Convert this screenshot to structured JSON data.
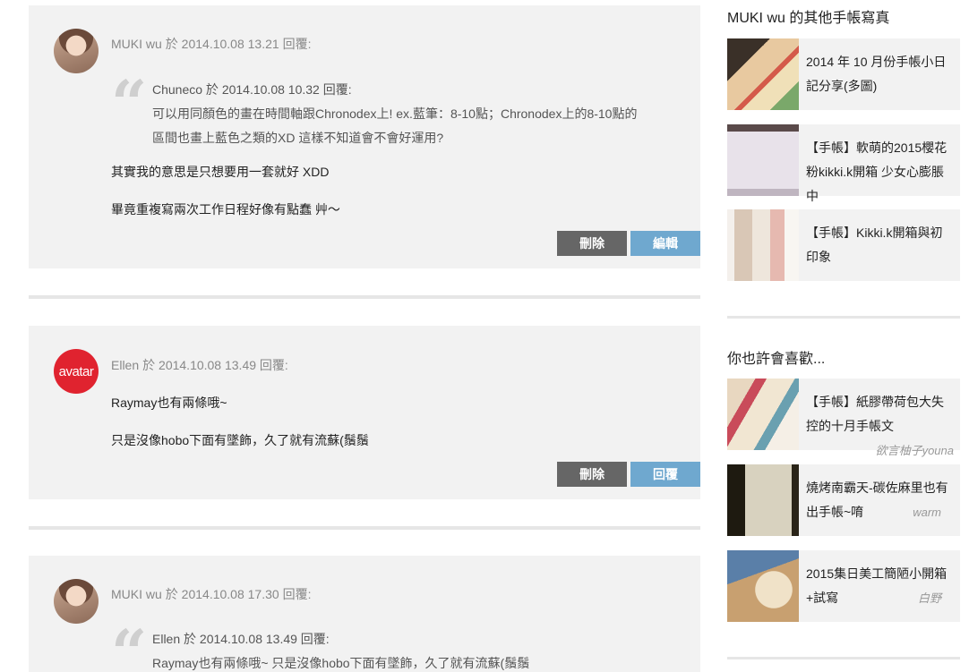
{
  "comments": [
    {
      "author": "MUKI wu",
      "date_text": "於 2014.10.08 13.21 回覆:",
      "quote_meta": "Chuneco 於 2014.10.08 10.32 回覆:",
      "quote_line1": "可以用同顏色的畫在時間軸跟Chronodex上! ex.藍筆：8-10點；Chronodex上的8-10點的",
      "quote_line2": "區間也畫上藍色之類的XD 這樣不知道會不會好運用?",
      "line1": "其實我的意思是只想要用一套就好 XDD",
      "line2": "畢竟重複寫兩次工作日程好像有點蠢 艸〜",
      "btn_left": "刪除",
      "btn_right": "編輯"
    },
    {
      "author": "Ellen",
      "avatar_text": "avatar",
      "date_text": "於 2014.10.08 13.49 回覆:",
      "line1": "Raymay也有兩條哦~",
      "line2": "只是沒像hobo下面有墜飾，久了就有流蘇(鬚鬚",
      "btn_left": "刪除",
      "btn_right": "回覆"
    },
    {
      "author": "MUKI wu",
      "date_text": "於 2014.10.08 17.30 回覆:",
      "quote_meta": "Ellen 於 2014.10.08 13.49 回覆:",
      "quote_line1": "Raymay也有兩條哦~ 只是沒像hobo下面有墜飾，久了就有流蘇(鬚鬚"
    }
  ],
  "sidebar": {
    "section1_title": "MUKI wu 的其他手帳寫真",
    "section1_items": [
      {
        "title": "2014 年 10 月份手帳小日記分享(多圖)"
      },
      {
        "title": "【手帳】軟萌的2015櫻花粉kikki.k開箱 少女心膨脹中"
      },
      {
        "title": "【手帳】Kikki.k開箱與初印象"
      }
    ],
    "section2_title": "你也許會喜歡...",
    "section2_items": [
      {
        "title": "【手帳】紙膠帶荷包大失控的十月手帳文",
        "author": "欲言柚子youna"
      },
      {
        "title": "燒烤南霸天-碳佐麻里也有出手帳~唷",
        "author": "warm"
      },
      {
        "title": "2015集日美工簡陋小開箱+試寫",
        "author": "白野"
      }
    ]
  },
  "colors": {
    "accent_blue": "#6fa8cf",
    "button_dark": "#666666",
    "panel_bg": "#f2f2f2"
  }
}
